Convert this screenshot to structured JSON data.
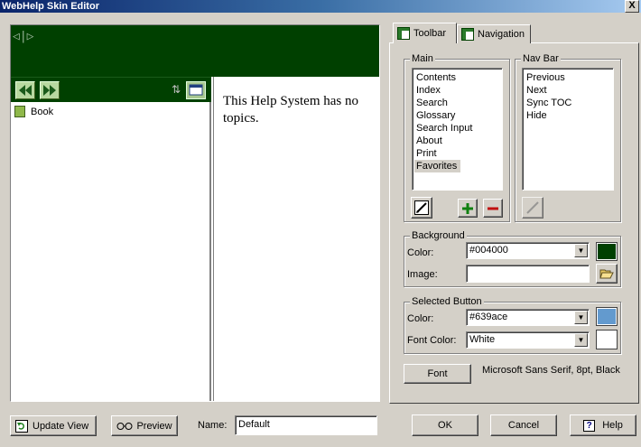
{
  "window": {
    "title": "WebHelp Skin Editor",
    "close_glyph": "X"
  },
  "preview": {
    "logo_text": "◁|▷",
    "toc_items": [
      {
        "label": "Book"
      }
    ],
    "content_text": "This Help System has no topics.",
    "colors": {
      "background": "#004000"
    }
  },
  "tabs": [
    {
      "label": "Toolbar",
      "active": true
    },
    {
      "label": "Navigation",
      "active": false
    }
  ],
  "main_group": {
    "label": "Main",
    "items": [
      "Contents",
      "Index",
      "Search",
      "Glossary",
      "Search Input",
      "About",
      "Print",
      "Favorites"
    ],
    "selected": "Favorites"
  },
  "navbar_group": {
    "label": "Nav Bar",
    "items": [
      "Previous",
      "Next",
      "Sync TOC",
      "Hide"
    ]
  },
  "background_group": {
    "label": "Background",
    "color_label": "Color:",
    "color_value": "#004000",
    "color_swatch": "#004000",
    "image_label": "Image:",
    "image_value": ""
  },
  "selected_button_group": {
    "label": "Selected Button",
    "color_label": "Color:",
    "color_value": "#639ace",
    "color_swatch": "#639ace",
    "font_color_label": "Font Color:",
    "font_color_value": "White",
    "font_color_swatch": "#ffffff"
  },
  "font": {
    "button_label": "Font",
    "description": "Microsoft Sans Serif, 8pt, Black"
  },
  "bottom_bar": {
    "update_view": "Update View",
    "preview": "Preview",
    "name_label": "Name:",
    "name_value": "Default",
    "ok": "OK",
    "cancel": "Cancel",
    "help": "Help"
  }
}
